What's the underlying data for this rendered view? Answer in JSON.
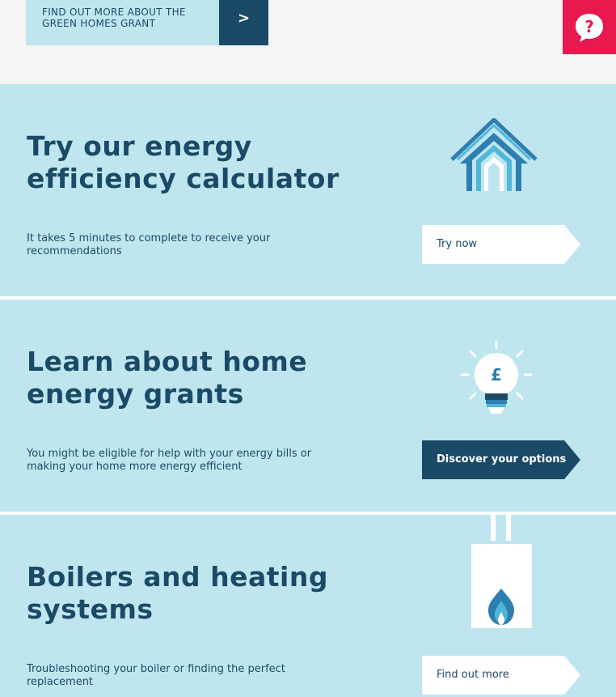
{
  "top_banner": {
    "grant_button_label": "FIND OUT MORE ABOUT THE GREEN HOMES GRANT",
    "grant_arrow": ">",
    "help_icon_glyph": "?"
  },
  "sections": [
    {
      "title": "Try our energy efficiency calculator",
      "description": "It takes 5 minutes to complete to receive your recommendations",
      "button_label": "Try now",
      "button_style": "light",
      "illustration": "house-icon"
    },
    {
      "title": "Learn about home energy grants",
      "description": "You might be eligible for help with your energy bills or making your home more energy efficient",
      "button_label": "Discover your options",
      "button_style": "dark",
      "illustration": "lightbulb-pound-icon",
      "bulb_symbol": "£"
    },
    {
      "title": "Boilers and heating systems",
      "description": "Troubleshooting your boiler or finding the perfect replacement",
      "button_label": "Find out more",
      "button_style": "light",
      "illustration": "boiler-icon"
    }
  ],
  "colors": {
    "section_background": "#bfe6ef",
    "navy": "#1b4a66",
    "help_pink": "#e8194f",
    "top_background": "#f5f5f5"
  }
}
